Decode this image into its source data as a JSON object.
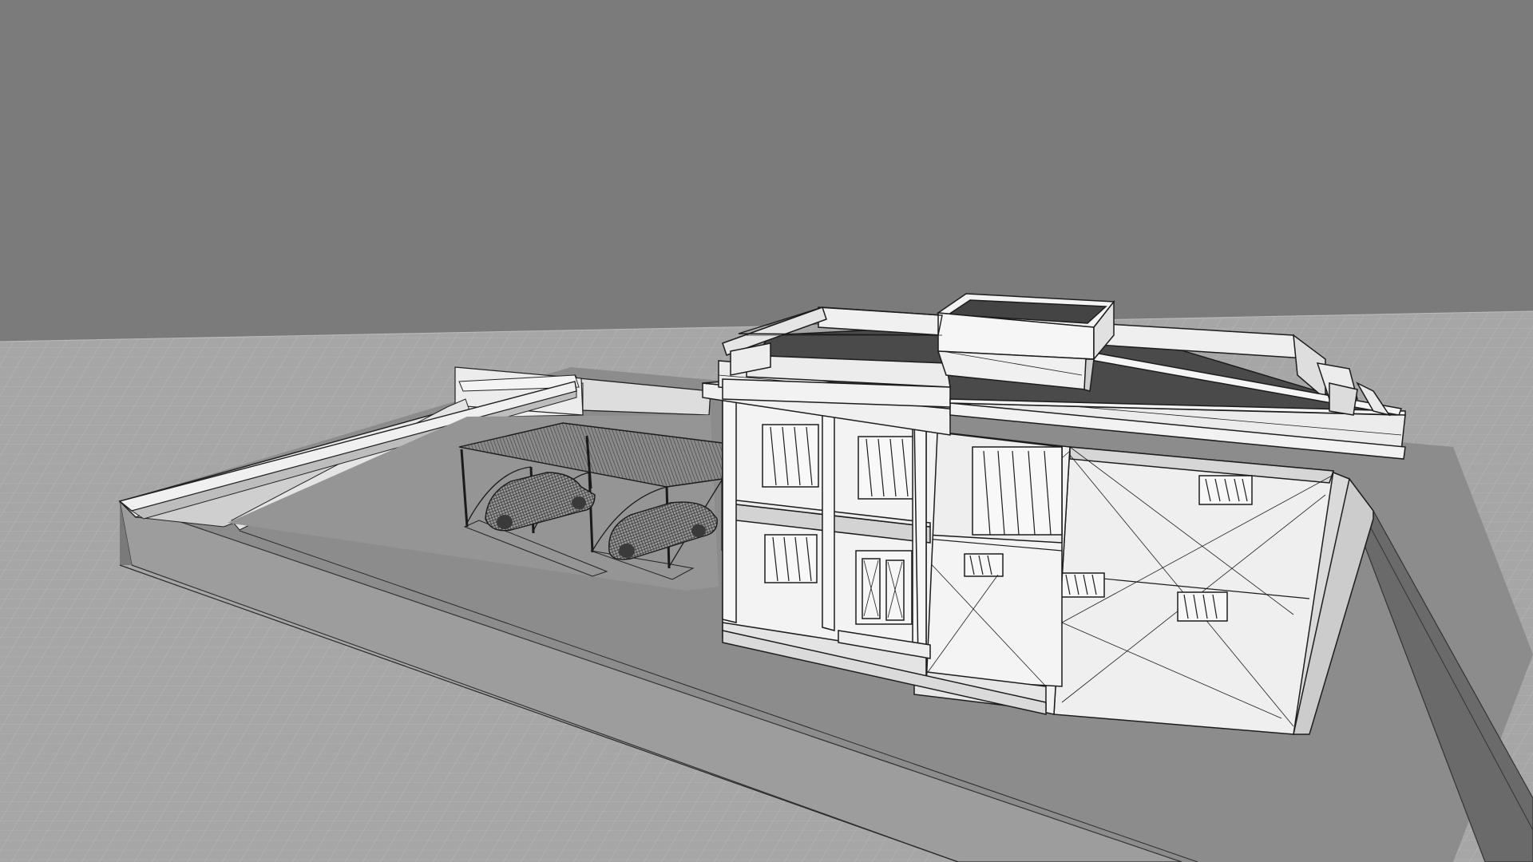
{
  "viewport": {
    "background_color": "#7b7b7b",
    "ground_color": "#a9a9a9",
    "grid_line_color": "#c8c8c8",
    "grid_major_color": "#d6d6d6"
  },
  "model": {
    "surface_light": "#f1f1f1",
    "surface_mid": "#dcdcdc",
    "surface_shadow": "#8f8f8f",
    "surface_dark": "#4a4a4a",
    "edge_color": "#222222",
    "icons": [
      "house-wireframe-model",
      "car-icon",
      "carport-canopy"
    ]
  }
}
